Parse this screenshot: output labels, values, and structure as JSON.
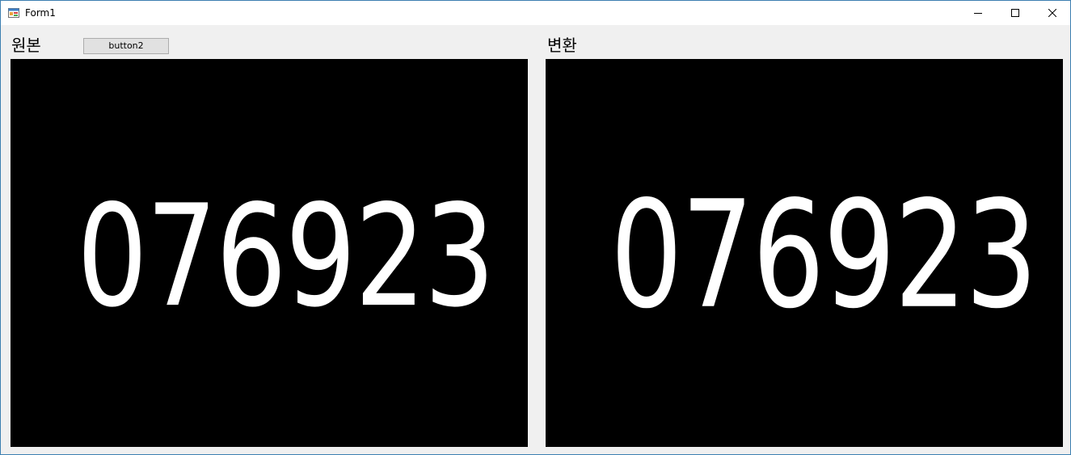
{
  "window": {
    "title": "Form1",
    "icon": "winforms-app-icon",
    "controls": {
      "minimize": "minimize-icon",
      "maximize": "maximize-icon",
      "close": "close-icon"
    }
  },
  "left_panel": {
    "label": "원본",
    "button_label": "button2",
    "image_text": "076923"
  },
  "right_panel": {
    "label": "변환",
    "image_text": "076923"
  },
  "colors": {
    "form_background": "#f0f0f0",
    "picture_background": "#000000",
    "digit_color": "#ffffff",
    "window_border": "#3c7fb1"
  }
}
